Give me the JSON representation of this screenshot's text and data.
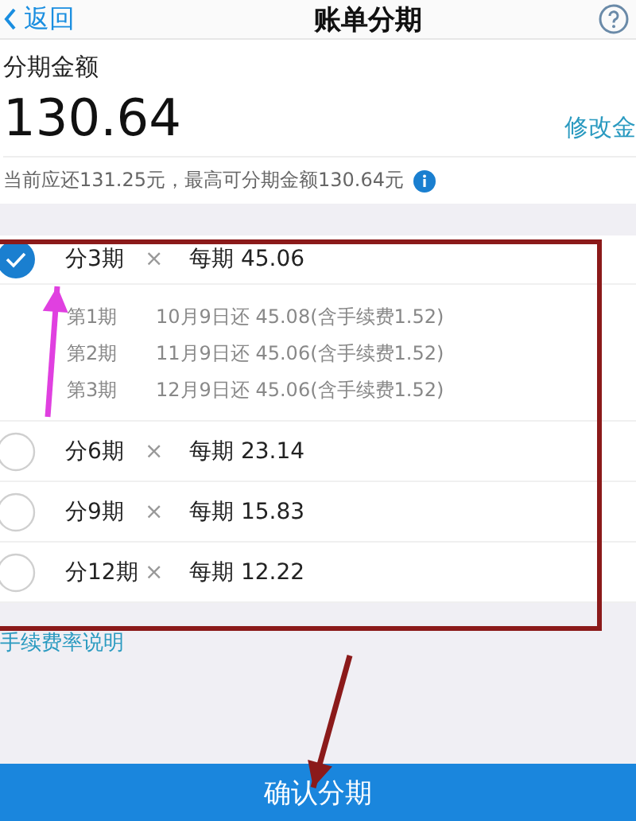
{
  "nav": {
    "back": "返回",
    "title": "账单分期"
  },
  "amount": {
    "label": "分期金额",
    "value": "130.64",
    "edit_link": "修改金",
    "note": "当前应还131.25元，最高可分期金额130.64元"
  },
  "plans": [
    {
      "periods": "分3期",
      "times": "×",
      "per": "每期 45.06",
      "selected": true,
      "schedule": [
        {
          "period": "第1期",
          "detail": "10月9日还 45.08(含手续费1.52)"
        },
        {
          "period": "第2期",
          "detail": "11月9日还 45.06(含手续费1.52)"
        },
        {
          "period": "第3期",
          "detail": "12月9日还 45.06(含手续费1.52)"
        }
      ]
    },
    {
      "periods": "分6期",
      "times": "×",
      "per": "每期 23.14",
      "selected": false
    },
    {
      "periods": "分9期",
      "times": "×",
      "per": "每期 15.83",
      "selected": false
    },
    {
      "periods": "分12期",
      "times": "×",
      "per": "每期 12.22",
      "selected": false
    }
  ],
  "fee_link": "手续费率说明",
  "confirm_button": "确认分期",
  "annotations": [
    {
      "kind": "frame",
      "color": "#8b1a1a"
    },
    {
      "kind": "arrow",
      "color": "#e040e0"
    },
    {
      "kind": "arrow",
      "color": "#8b1a1a"
    }
  ]
}
